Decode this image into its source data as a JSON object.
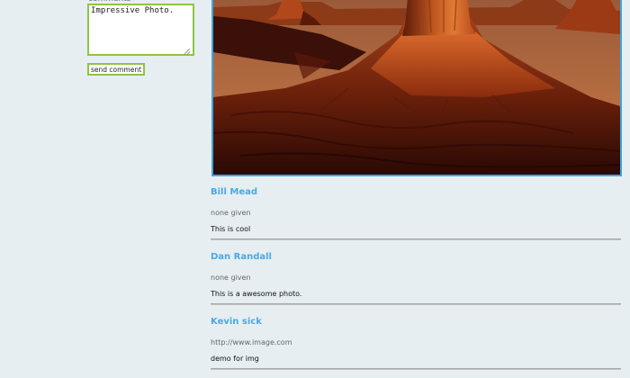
{
  "form": {
    "label": "comments",
    "comment_value": "Impressive Photo.",
    "send_label": "send comment"
  },
  "photo": {
    "description_icon": "desert-butte-photo"
  },
  "comments": [
    {
      "name": "Bill Mead",
      "website": "none given",
      "text": "This is cool"
    },
    {
      "name": "Dan Randall",
      "website": "none given",
      "text": "This is a awesome photo."
    },
    {
      "name": "Kevin sick",
      "website": "http://www.image.com",
      "text": "demo for img"
    }
  ],
  "colors": {
    "page_bg": "#e6eef1",
    "accent_green": "#8cc63f",
    "accent_blue": "#3ea6e0",
    "name_blue": "#4aa8e4"
  }
}
